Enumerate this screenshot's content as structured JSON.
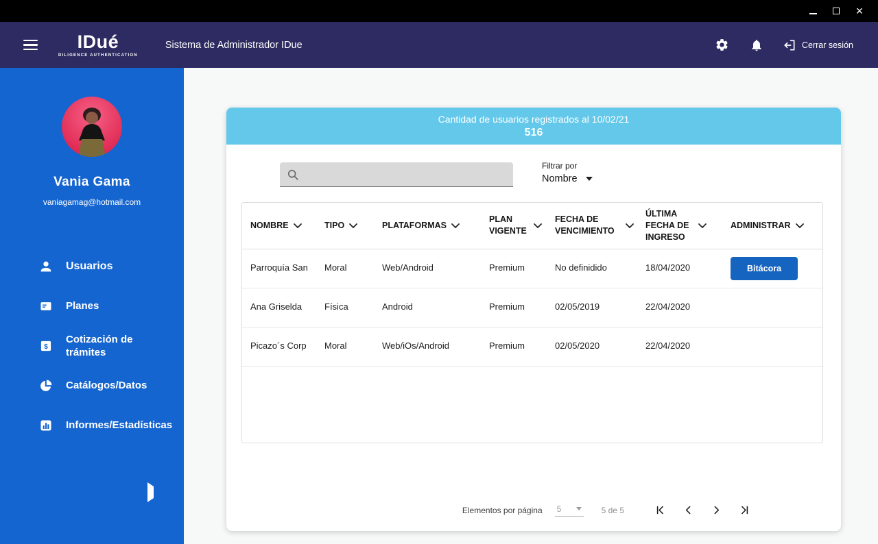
{
  "colors": {
    "appbar_bg": "#2e2b62",
    "sidebar_bg": "#1565d0",
    "card_header_bg": "#63c8ea",
    "accent_blue": "#1565c0"
  },
  "header": {
    "logo_title": "IDué",
    "logo_subtitle": "DILIGENCE AUTHENTICATION",
    "app_title": "Sistema de Administrador IDue",
    "logout_label": "Cerrar sesión"
  },
  "sidebar": {
    "user": {
      "name": "Vania Gama",
      "email": "vaniagamag@hotmail.com"
    },
    "items": [
      {
        "label": "Usuarios",
        "icon": "person-icon"
      },
      {
        "label": "Planes",
        "icon": "plans-card-icon"
      },
      {
        "label": "Cotización de trámites",
        "icon": "dollar-square-icon"
      },
      {
        "label": "Catálogos/Datos",
        "icon": "pie-chart-icon"
      },
      {
        "label": "Informes/Estadísticas",
        "icon": "bar-chart-icon"
      }
    ]
  },
  "main": {
    "card_title": "Cantidad de usuarios registrados al 10/02/21",
    "card_count": "516",
    "search": {
      "value": ""
    },
    "filter": {
      "label": "Filtrar por",
      "value": "Nombre"
    },
    "table": {
      "columns": [
        "NOMBRE",
        "TIPO",
        "PLATAFORMAS",
        "PLAN VIGENTE",
        "FECHA DE VENCIMIENTO",
        "ÚLTIMA FECHA DE INGRESO",
        "ADMINISTRAR"
      ],
      "rows": [
        {
          "nombre": "Parroquía San",
          "tipo": "Moral",
          "plataformas": "Web/Android",
          "plan": "Premium",
          "vencimiento": "No definidido",
          "ultimo_ingreso": "18/04/2020",
          "accion": "Bitácora"
        },
        {
          "nombre": "Ana Griselda",
          "tipo": "Física",
          "plataformas": "Android",
          "plan": "Premium",
          "vencimiento": "02/05/2019",
          "ultimo_ingreso": "22/04/2020",
          "accion": ""
        },
        {
          "nombre": "Picazo´s Corp",
          "tipo": "Moral",
          "plataformas": "Web/iOs/Android",
          "plan": "Premium",
          "vencimiento": "02/05/2020",
          "ultimo_ingreso": "22/04/2020",
          "accion": ""
        }
      ]
    },
    "pagination": {
      "label": "Elementos por página",
      "page_size": "5",
      "range_text": "5 de 5"
    }
  }
}
